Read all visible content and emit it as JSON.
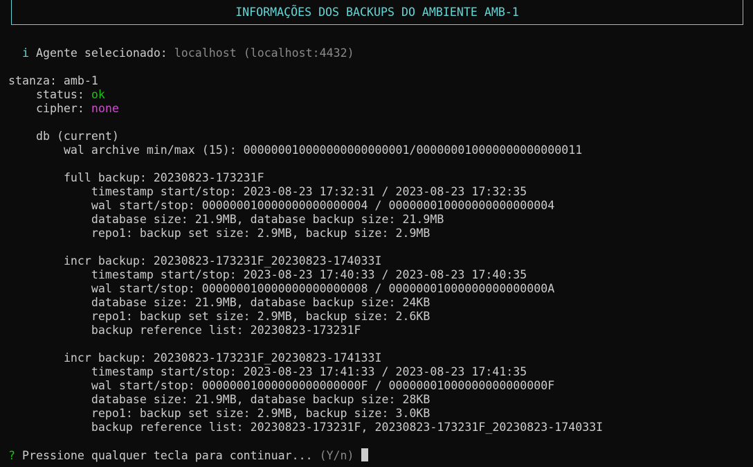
{
  "banner": {
    "title": "INFORMAÇÕES DOS BACKUPS DO AMBIENTE AMB-1"
  },
  "agent": {
    "info_icon": "i",
    "label": "Agente selecionado: ",
    "name": "localhost",
    "address": "(localhost:4432)"
  },
  "stanza": {
    "line": "stanza: amb-1",
    "status_label": "status: ",
    "status_value": "ok",
    "cipher_label": "cipher: ",
    "cipher_value": "none",
    "db_line": "db (current)",
    "wal_archive": "wal archive min/max (15): 000000010000000000000001/000000010000000000000011"
  },
  "backups": [
    {
      "header": "full backup: 20230823-173231F",
      "timestamp": "timestamp start/stop: 2023-08-23 17:32:31 / 2023-08-23 17:32:35",
      "wal": "wal start/stop: 000000010000000000000004 / 000000010000000000000004",
      "db_size": "database size: 21.9MB, database backup size: 21.9MB",
      "repo": "repo1: backup set size: 2.9MB, backup size: 2.9MB"
    },
    {
      "header": "incr backup: 20230823-173231F_20230823-174033I",
      "timestamp": "timestamp start/stop: 2023-08-23 17:40:33 / 2023-08-23 17:40:35",
      "wal": "wal start/stop: 000000010000000000000008 / 00000001000000000000000A",
      "db_size": "database size: 21.9MB, database backup size: 24KB",
      "repo": "repo1: backup set size: 2.9MB, backup size: 2.6KB",
      "reference": "backup reference list: 20230823-173231F"
    },
    {
      "header": "incr backup: 20230823-173231F_20230823-174133I",
      "timestamp": "timestamp start/stop: 2023-08-23 17:41:33 / 2023-08-23 17:41:35",
      "wal": "wal start/stop: 00000001000000000000000F / 00000001000000000000000F",
      "db_size": "database size: 21.9MB, database backup size: 28KB",
      "repo": "repo1: backup set size: 2.9MB, backup size: 3.0KB",
      "reference": "backup reference list: 20230823-173231F, 20230823-173231F_20230823-174033I"
    }
  ],
  "prompt": {
    "mark": "?",
    "text": " Pressione qualquer tecla para continuar... ",
    "hint": "(Y/n)"
  }
}
